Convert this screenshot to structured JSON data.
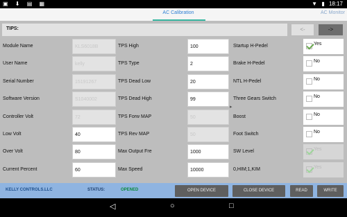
{
  "status_bar": {
    "left_icons": "▣ ⬇ ▤ ▦",
    "wifi": "▼",
    "battery": "▮",
    "time": "18:17"
  },
  "tabs": {
    "calibration": "AC Calibration",
    "monitor": "AC Monitor"
  },
  "tips_label": "TIPS:",
  "nav_buttons": {
    "prev": "<-",
    "next": "->"
  },
  "col1": [
    {
      "label": "Module Name",
      "value": "KLS6018B",
      "disabled": true
    },
    {
      "label": "User Name",
      "value": "kelly",
      "disabled": true
    },
    {
      "label": "Serial Number",
      "value": "15191267",
      "disabled": true
    },
    {
      "label": "Software Version",
      "value": "S1040002",
      "disabled": true
    },
    {
      "label": "Controller Volt",
      "value": "72",
      "disabled": true
    },
    {
      "label": "Low Volt",
      "value": "40",
      "disabled": false
    },
    {
      "label": "Over Volt",
      "value": "80",
      "disabled": false
    },
    {
      "label": "Current Percent",
      "value": "60",
      "disabled": false
    }
  ],
  "col2": [
    {
      "label": "TPS High",
      "value": "100",
      "disabled": false
    },
    {
      "label": "TPS Type",
      "value": "2",
      "disabled": false
    },
    {
      "label": "TPS Dead Low",
      "value": "20",
      "disabled": false
    },
    {
      "label": "TPS Dead High",
      "value": "99",
      "disabled": false
    },
    {
      "label": "TPS Forw MAP",
      "value": "50",
      "disabled": true
    },
    {
      "label": "TPS Rev MAP",
      "value": "50",
      "disabled": true
    },
    {
      "label": "Max Output Fre",
      "value": "1000",
      "disabled": false
    },
    {
      "label": "Max Speed",
      "value": "10000",
      "disabled": false
    }
  ],
  "col3": [
    {
      "label": "Startup H-Pedel",
      "text": "Yes",
      "checked": true,
      "disabled": false
    },
    {
      "label": "Brake H-Pedel",
      "text": "No",
      "checked": false,
      "disabled": false
    },
    {
      "label": "NTL H-Pedel",
      "text": "No",
      "checked": false,
      "disabled": false
    },
    {
      "label": "Three Gears Switch",
      "text": "No",
      "checked": false,
      "disabled": false
    },
    {
      "label": "Boost",
      "text": "No",
      "checked": false,
      "disabled": false
    },
    {
      "label": "Foot Switch",
      "text": "No",
      "checked": false,
      "disabled": false
    },
    {
      "label": "SW Level",
      "text": "Yes",
      "checked": true,
      "disabled": true
    },
    {
      "label": "0,HIM;1,KIM",
      "text": "Yes",
      "checked": true,
      "disabled": true
    }
  ],
  "footer": {
    "company": "KELLY CONTROLS.LLC",
    "status_label": "STATUS:",
    "status_value": "OPENED",
    "open_device": "OPEN DEVICE",
    "close_device": "CLOSE DEVICE",
    "read": "READ",
    "write": "WRITE"
  },
  "android_nav": {
    "back": "◁",
    "home": "○",
    "recents": "□"
  }
}
